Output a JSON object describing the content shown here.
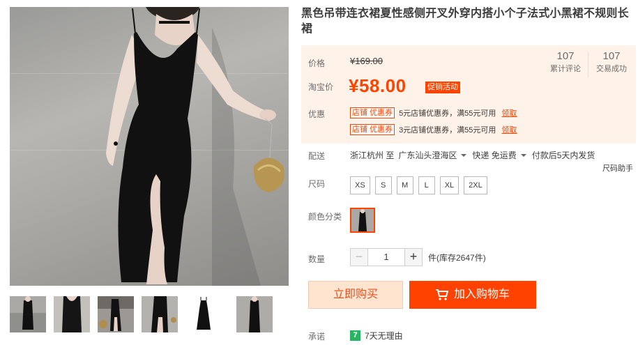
{
  "product": {
    "title": "黑色吊带连衣裙夏性感侧开叉外穿内搭小个子法式小黑裙不规则长裙"
  },
  "price": {
    "label": "价格",
    "original": "¥169.00",
    "promo_label": "淘宝价",
    "promo_price": "¥58.00",
    "promo_badge": "促销活动"
  },
  "stats": [
    {
      "value": "107",
      "label": "累计评论"
    },
    {
      "value": "107",
      "label": "交易成功"
    }
  ],
  "coupons": {
    "label": "优惠",
    "items": [
      {
        "tag": "店铺 优惠券",
        "text": "5元店铺优惠券，满55元可用",
        "action": "领取"
      },
      {
        "tag": "店铺 优惠券",
        "text": "3元店铺优惠券，满55元可用",
        "action": "领取"
      }
    ]
  },
  "shipping": {
    "label": "配送",
    "from": "浙江杭州 至",
    "to": "广东汕头澄海区",
    "method": "快递 免运费",
    "dispatch": "付款后5天内发货"
  },
  "size": {
    "label": "尺码",
    "help": "尺码助手",
    "options": [
      "XS",
      "S",
      "M",
      "L",
      "XL",
      "2XL"
    ]
  },
  "color": {
    "label": "颜色分类"
  },
  "quantity": {
    "label": "数量",
    "value": "1",
    "minus": "−",
    "plus": "+",
    "stock": "件(库存2647件)"
  },
  "actions": {
    "buy_now": "立即购买",
    "add_to_cart": "加入购物车"
  },
  "promise": {
    "label": "承诺",
    "badge": "7",
    "text": "7天无理由"
  },
  "colors": {
    "accent": "#ff4400",
    "price_bg": "#fff2e8",
    "buy_now_bg": "#ffe4d0",
    "cart_bg": "#ff4200",
    "promise_green": "#28b462"
  },
  "icons": {
    "cart": "shopping-cart-icon",
    "caret": "chevron-down-icon"
  }
}
